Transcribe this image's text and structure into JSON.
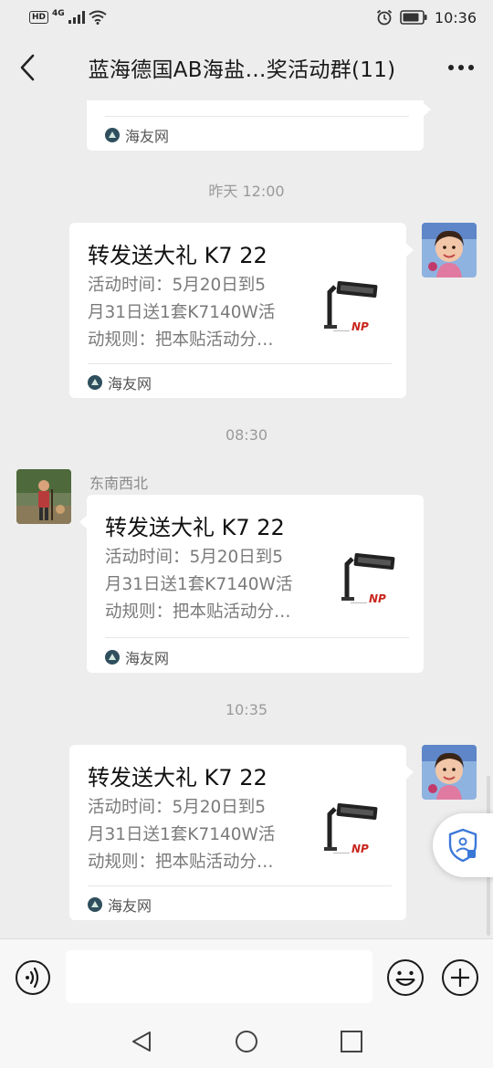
{
  "status_bar": {
    "hd": "HD",
    "network": "4G",
    "time": "10:36"
  },
  "header": {
    "title": "蓝海德国AB海盐…奖活动群(11)"
  },
  "messages": {
    "partial_card": {
      "source": "海友网"
    },
    "ts1": "昨天 12:00",
    "ts2": "08:30",
    "ts3": "10:35",
    "sender_name": "东南西北",
    "card": {
      "title": "转发送大礼 K7 22",
      "desc_lines": [
        "活动时间：5月20日到5",
        "月31日送1套K7140W活",
        "动规则：把本贴活动分…"
      ],
      "thumb_brand": "NP",
      "source": "海友网"
    }
  },
  "input": {
    "placeholder": ""
  },
  "colors": {
    "background": "#ededed",
    "bubble": "#ffffff",
    "thumb_red": "#c8261f"
  },
  "icons": {
    "back": "chevron-left-icon",
    "more": "more-dots-icon",
    "voice": "voice-icon",
    "emoji": "emoji-icon",
    "plus": "plus-icon",
    "shield": "shield-icon"
  }
}
